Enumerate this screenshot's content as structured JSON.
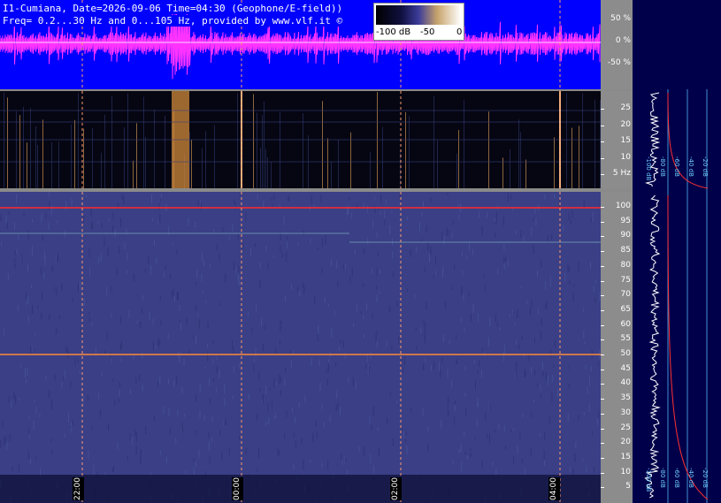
{
  "header": {
    "line1": "I1-Cumiana, Date=2026-09-06 Time=04:30 (Geophone/E-field))",
    "line2": "Freq= 0.2...30 Hz and 0...105 Hz, provided by www.vlf.it ©"
  },
  "colorbar": {
    "labels": [
      "-100 dB",
      "-50",
      "0"
    ]
  },
  "wave_scale": [
    "50 %",
    "0 %",
    "-50 %"
  ],
  "low_scale": [
    "25",
    "20",
    "15",
    "10",
    "5 Hz"
  ],
  "high_scale": [
    "100",
    "95",
    "90",
    "85",
    "80",
    "75",
    "70",
    "65",
    "60",
    "55",
    "50",
    "45",
    "40",
    "35",
    "30",
    "25",
    "20",
    "15",
    "10",
    "5"
  ],
  "time_labels": [
    "22:00",
    "00:00",
    "02:00",
    "04:00"
  ],
  "db_labels_low": [
    "-100 dB",
    "-80 dB",
    "-60 dB",
    "-40 dB",
    "-20 dB"
  ],
  "db_labels_high": [
    "-100 dB",
    "-80 dB",
    "-60 dB",
    "-40 dB",
    "-20 dB"
  ],
  "colors": {
    "wave_bg": "#0000ff",
    "wave_signal": "#ff33ff",
    "spectrogram_bg": "#3a3f86",
    "marker_line": "#ff2a2a",
    "grid_dash": "#ff9a6a",
    "profile_bg": "#00004a",
    "profile_grid": "#3f8fd0"
  }
}
